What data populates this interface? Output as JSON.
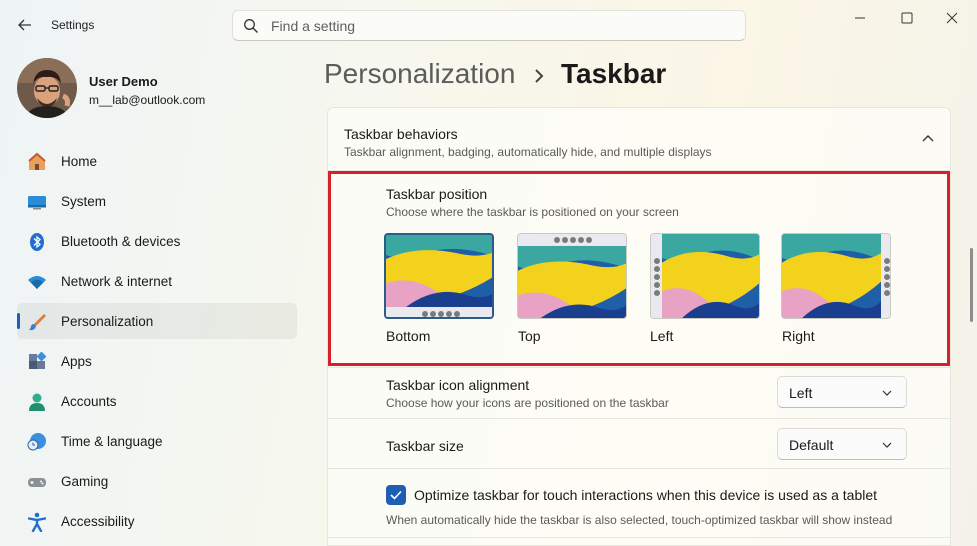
{
  "window": {
    "app_title": "Settings"
  },
  "search": {
    "placeholder": "Find a setting"
  },
  "user": {
    "name": "User Demo",
    "email": "m__lab@outlook.com"
  },
  "sidebar": {
    "items": [
      {
        "label": "Home",
        "icon": "home-icon",
        "active": false
      },
      {
        "label": "System",
        "icon": "system-icon",
        "active": false
      },
      {
        "label": "Bluetooth & devices",
        "icon": "bluetooth-icon",
        "active": false
      },
      {
        "label": "Network & internet",
        "icon": "wifi-icon",
        "active": false
      },
      {
        "label": "Personalization",
        "icon": "brush-icon",
        "active": true
      },
      {
        "label": "Apps",
        "icon": "apps-icon",
        "active": false
      },
      {
        "label": "Accounts",
        "icon": "person-icon",
        "active": false
      },
      {
        "label": "Time & language",
        "icon": "clock-globe-icon",
        "active": false
      },
      {
        "label": "Gaming",
        "icon": "gamepad-icon",
        "active": false
      },
      {
        "label": "Accessibility",
        "icon": "accessibility-icon",
        "active": false
      }
    ]
  },
  "breadcrumb": {
    "parent": "Personalization",
    "current": "Taskbar"
  },
  "behaviors": {
    "title": "Taskbar behaviors",
    "subtitle": "Taskbar alignment, badging, automatically hide, and multiple displays"
  },
  "taskbar_position": {
    "title": "Taskbar position",
    "subtitle": "Choose where the taskbar is positioned on your screen",
    "options": [
      {
        "label": "Bottom",
        "selected": true
      },
      {
        "label": "Top",
        "selected": false
      },
      {
        "label": "Left",
        "selected": false
      },
      {
        "label": "Right",
        "selected": false
      }
    ]
  },
  "icon_alignment": {
    "title": "Taskbar icon alignment",
    "subtitle": "Choose how your icons are positioned on the taskbar",
    "value": "Left"
  },
  "taskbar_size": {
    "title": "Taskbar size",
    "value": "Default"
  },
  "touch_optimize": {
    "label": "Optimize taskbar for touch interactions when this device is used as a tablet",
    "note": "When automatically hide the taskbar is also selected, touch-optimized taskbar will show instead",
    "checked": true
  },
  "colors": {
    "accent": "#1e5fb4",
    "highlight_border": "#d6202a"
  }
}
